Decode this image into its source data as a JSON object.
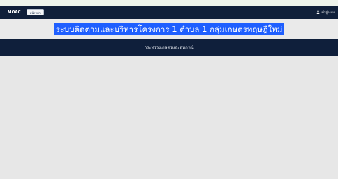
{
  "navbar": {
    "brand": "MOAC",
    "nav_button_label": "หน้าหลัก",
    "user_label": "เข้าสู่ระบบ"
  },
  "header": {
    "title": "ระบบติดตามและบริหารโครงการ 1 ตำบล 1 กลุ่มเกษตรทฤษฎีใหม่",
    "subtitle": "กระทรวงเกษตรและสหกรณ์"
  },
  "colors": {
    "navbar": "#10203a",
    "title_highlight": "#1f5fff",
    "subtitle_band": "#0f1f3b",
    "background": "#e7e7e7"
  },
  "icons": {
    "user": "user-icon"
  }
}
